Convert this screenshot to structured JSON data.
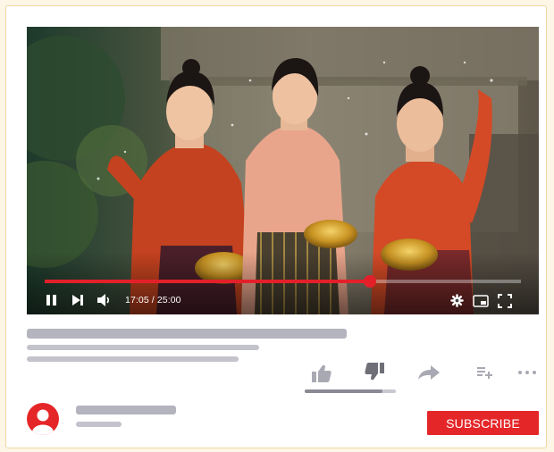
{
  "player": {
    "time_display": "17:05 / 25:00",
    "progress_fraction": 0.683,
    "accent_color": "#e3202a",
    "icons": [
      "pause-icon",
      "skip-next-icon",
      "volume-icon",
      "settings-icon",
      "miniplayer-icon",
      "fullscreen-icon"
    ]
  },
  "actions": {
    "icons": [
      "like-icon",
      "dislike-icon",
      "share-icon",
      "add-to-playlist-icon",
      "more-icon"
    ],
    "like_ratio_fraction": 0.85
  },
  "channel": {
    "avatar_icon": "user-avatar-icon",
    "subscribe_label": "SUBSCRIBE",
    "subscribe_color": "#e52629"
  }
}
